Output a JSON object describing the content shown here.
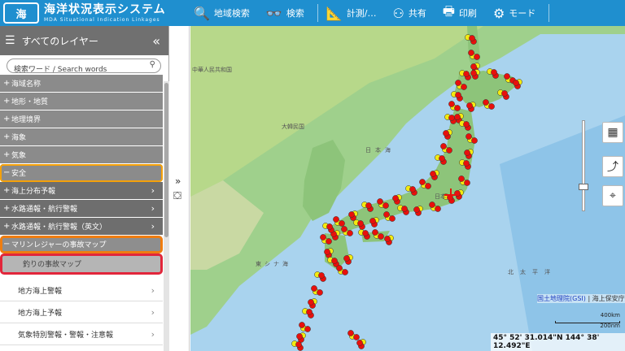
{
  "header": {
    "logo_mark": "海",
    "title": "海洋状況表示システム",
    "subtitle": "MDA Situational Indication Linkages",
    "tools": [
      {
        "icon": "magnifier-icon",
        "glyph": "🔍",
        "label": "地域検索"
      },
      {
        "icon": "binoculars-icon",
        "glyph": "👓",
        "label": "検索"
      },
      {
        "icon": "measure-icon",
        "glyph": "📐",
        "label": "計測/…"
      },
      {
        "icon": "share-icon",
        "glyph": "⚇",
        "label": "共有"
      },
      {
        "icon": "print-icon",
        "glyph": "🖶",
        "label": "印刷"
      },
      {
        "icon": "mode-icon",
        "glyph": "⚙",
        "label": "モード"
      }
    ],
    "color": "#1f8fcf"
  },
  "sidebar": {
    "title": "すべてのレイヤー",
    "search_placeholder": "検索ワード / Search words",
    "layers": [
      {
        "prefix": "+",
        "label": "海域名称"
      },
      {
        "prefix": "+",
        "label": "地形・地質"
      },
      {
        "prefix": "+",
        "label": "地理境界"
      },
      {
        "prefix": "+",
        "label": "海象"
      },
      {
        "prefix": "+",
        "label": "気象"
      },
      {
        "prefix": "−",
        "label": "安全"
      },
      {
        "prefix": "+",
        "label": "海上分布予報",
        "arrow": "›"
      },
      {
        "prefix": "+",
        "label": "水路通報・航行警報",
        "arrow": "›"
      },
      {
        "prefix": "+",
        "label": "水路通報・航行警報（英文）",
        "arrow": "›"
      },
      {
        "prefix": "−",
        "label": "マリンレジャーの事故マップ"
      },
      {
        "prefix": "",
        "label": "釣りの事故マップ"
      }
    ],
    "items": [
      {
        "label": "地方海上警報",
        "arrow": "›"
      },
      {
        "label": "地方海上予報",
        "arrow": "›"
      },
      {
        "label": "気象特別警報・警報・注意報",
        "arrow": "›"
      }
    ],
    "highlight_orange": "#f5a10a",
    "highlight_red": "#e2263b"
  },
  "map": {
    "labels": {
      "china": "中華人民共和国",
      "korea": "大韓民国",
      "sea_of_japan": "日本海",
      "east_china_sea": "東シナ海",
      "pacific": "北太平洋",
      "japan": "日本"
    },
    "attribution_link": "国土地理院(GSI)",
    "attribution_text": "| 海上保安庁",
    "scale_top": "400km",
    "scale_bottom": "200nm",
    "coordinates": "45° 52' 31.014\"N 144° 38' 12.492\"E",
    "marker_red": "#e8100c",
    "marker_yellow": "#f4ea10"
  }
}
